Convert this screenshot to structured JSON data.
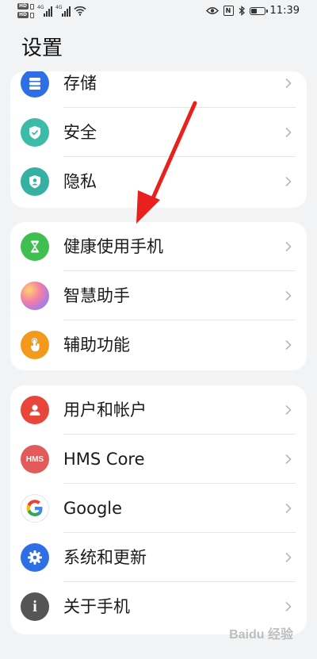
{
  "status_bar": {
    "sim1": "HD",
    "sim2": "HD",
    "network1": "4G",
    "network2": "4G",
    "nfc": "N",
    "battery_level": 0.5,
    "time": "11:39"
  },
  "page": {
    "title": "设置"
  },
  "groups": [
    {
      "items": [
        {
          "label": "存储",
          "icon": "storage-icon",
          "color": "#2f6fe6"
        },
        {
          "label": "安全",
          "icon": "shield-check-icon",
          "color": "#3cbba8"
        },
        {
          "label": "隐私",
          "icon": "privacy-shield-icon",
          "color": "#36b0a2"
        }
      ]
    },
    {
      "items": [
        {
          "label": "健康使用手机",
          "icon": "hourglass-icon",
          "color": "#3fbf4f"
        },
        {
          "label": "智慧助手",
          "icon": "smart-assistant-icon",
          "color": "#c47ad8"
        },
        {
          "label": "辅助功能",
          "icon": "hand-touch-icon",
          "color": "#f39a1d"
        }
      ]
    },
    {
      "items": [
        {
          "label": "用户和帐户",
          "icon": "user-icon",
          "color": "#e8463a"
        },
        {
          "label": "HMS Core",
          "icon": "hms-core-icon",
          "icon_text": "HMS",
          "color": "#e25a5a"
        },
        {
          "label": "Google",
          "icon": "google-icon",
          "icon_text": "G",
          "color": "#ffffff"
        },
        {
          "label": "系统和更新",
          "icon": "gear-icon",
          "color": "#2f6fe6"
        },
        {
          "label": "关于手机",
          "icon": "info-icon",
          "icon_text": "i",
          "color": "#555555"
        }
      ]
    }
  ],
  "annotation": {
    "color": "#e8201e"
  },
  "watermark": {
    "text": "Baidu 经验"
  }
}
